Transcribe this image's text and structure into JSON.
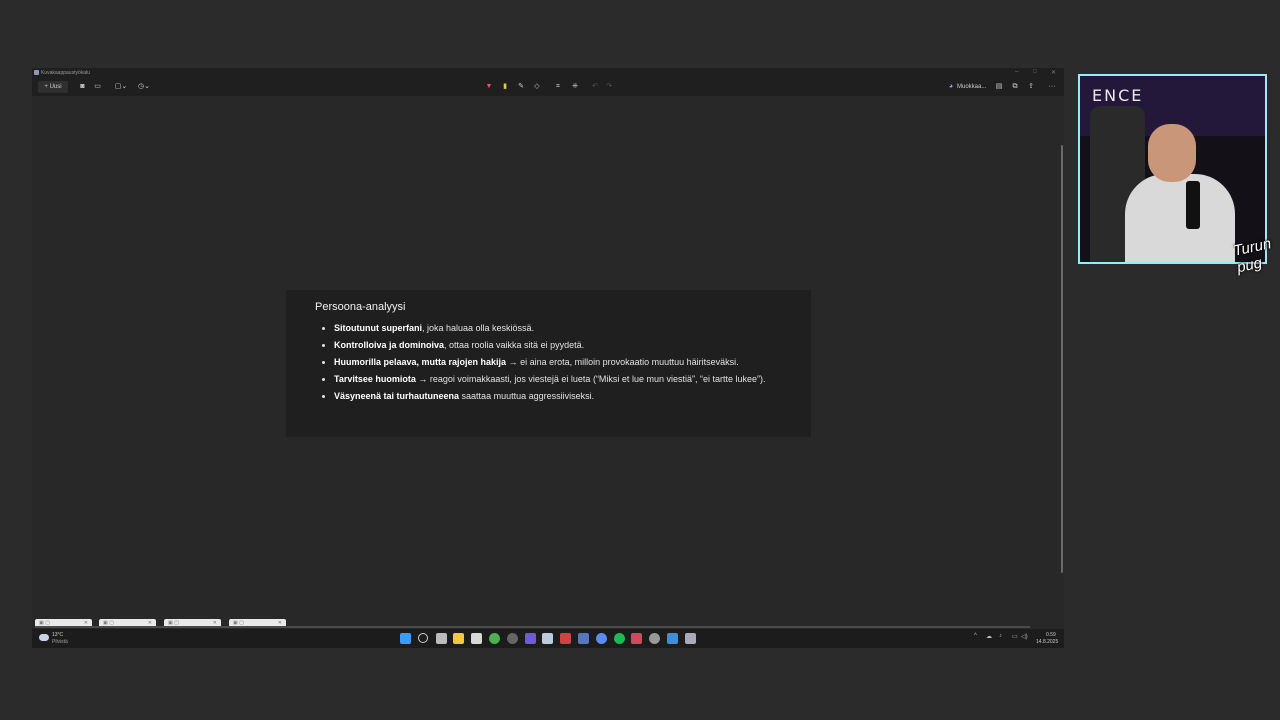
{
  "window": {
    "title": "Kuvakaappaustyökalu",
    "controls": [
      "–",
      "□",
      "✕"
    ]
  },
  "toolbar": {
    "new_label": "+ Uusi",
    "edit_label": "Muokkaa...",
    "more_label": "···"
  },
  "card": {
    "heading": "Persoona-analyysi",
    "items": [
      {
        "bold": "Sitoutunut superfani",
        "rest": ", joka haluaa olla keskiössä."
      },
      {
        "bold": "Kontrolloiva ja dominoiva",
        "rest": ", ottaa roolia vaikka sitä ei pyydetä."
      },
      {
        "bold": "Huumorilla pelaava, mutta rajojen hakija",
        "rest": " → ei aina erota, milloin provokaatio muuttuu häiritseväksi."
      },
      {
        "bold": "Tarvitsee huomiota →",
        "rest": " reagoi voimakkaasti, jos viestejä ei lueta (“Miksi et lue mun viestiä”, “ei tartte lukee”)."
      },
      {
        "bold": "Väsyneenä tai turhautuneena",
        "rest": " saattaa muuttua aggressiiviseksi."
      }
    ]
  },
  "taskbar": {
    "weather_temp": "13°C",
    "weather_desc": "Pilvistä",
    "time": "0.59",
    "date": "14.8.2025"
  },
  "webcam": {
    "logo": "ENCE",
    "watermark": "Turun pug"
  },
  "colors": {
    "accent_red": "#e0586a",
    "highlighter_yellow": "#e8c64a",
    "webcam_border": "#9fe6ff"
  }
}
